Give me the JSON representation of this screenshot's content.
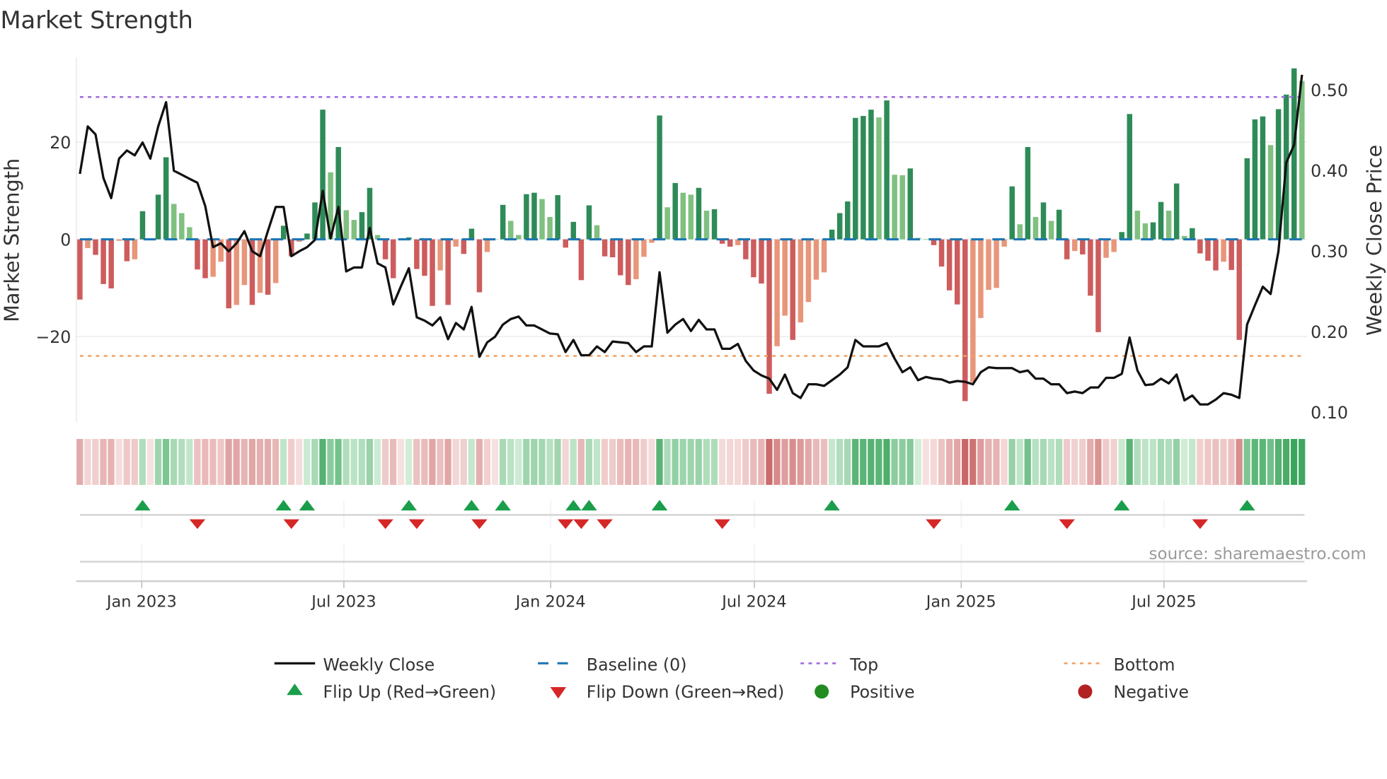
{
  "title": "Market Strength",
  "source": "source: sharemaestro.com",
  "chart_data": {
    "type": "bar",
    "title": "Market Strength",
    "ylabel": "Market Strength",
    "y2label": "Weekly Close Price",
    "ylim": [
      -37.5,
      37.5
    ],
    "y2lim": [
      0.082,
      0.56
    ],
    "yticks": [
      {
        "value": 20,
        "label": "20"
      },
      {
        "value": 0,
        "label": "0"
      },
      {
        "value": -20,
        "label": "−20"
      }
    ],
    "y2ticks": [
      {
        "value": 0.5,
        "label": "0.50"
      },
      {
        "value": 0.4,
        "label": "0.40"
      },
      {
        "value": 0.3,
        "label": "0.30"
      },
      {
        "value": 0.2,
        "label": "0.20"
      },
      {
        "value": 0.1,
        "label": "0.10"
      }
    ],
    "xticks": [
      {
        "week": 7.9,
        "label": "Jan 2023"
      },
      {
        "week": 33.7,
        "label": "Jul 2023"
      },
      {
        "week": 60.1,
        "label": "Jan 2024"
      },
      {
        "week": 86.1,
        "label": "Jul 2024"
      },
      {
        "week": 112.5,
        "label": "Jan 2025"
      },
      {
        "week": 138.4,
        "label": "Jul 2025"
      }
    ],
    "top_level": 29.3,
    "bottom_level": -24,
    "baseline": 0,
    "strength": [
      -12.4,
      -1.8,
      -3.2,
      -9.2,
      -10.1,
      -0.3,
      -4.5,
      -4.1,
      5.8,
      0,
      9.2,
      16.9,
      7.3,
      5.4,
      2.5,
      -6.2,
      -8,
      -7.7,
      -4.6,
      -14.2,
      -13.5,
      -9.4,
      -13.5,
      -11,
      -11.4,
      -9,
      2.8,
      -3.5,
      -0.5,
      1.2,
      7.6,
      26.7,
      13.8,
      19,
      6,
      4,
      5.6,
      10.6,
      0.9,
      -4.1,
      -8,
      0,
      0.4,
      -6.1,
      -7.5,
      -13.7,
      -6.4,
      -13.5,
      -1.5,
      -3,
      2.2,
      -10.9,
      -2.6,
      0,
      7.1,
      3.8,
      0.9,
      9.3,
      9.6,
      8.3,
      4.6,
      9.1,
      -1.7,
      3.6,
      -8.4,
      7,
      2.9,
      -3.5,
      -3.7,
      -7.4,
      -9.4,
      -8.2,
      -3.6,
      -0.7,
      25.5,
      6.6,
      11.6,
      9.6,
      9.2,
      10.6,
      5.9,
      6.2,
      -0.9,
      -1.5,
      -1.2,
      -4.1,
      -7.8,
      -9.1,
      -31.8,
      -22,
      -15.7,
      -20.7,
      -17.1,
      -12.9,
      -8.3,
      -6.8,
      2,
      5.4,
      7.8,
      25,
      25.4,
      26.7,
      25.1,
      28.6,
      13.3,
      13.2,
      14.6,
      0.3,
      0,
      -1.2,
      -5.6,
      -10.5,
      -13.4,
      -33.3,
      -29.4,
      -16.2,
      -10.4,
      -10,
      -1.5,
      10.9,
      3.1,
      19,
      4.6,
      7.6,
      3.8,
      6.1,
      -4.1,
      -2.4,
      -3.1,
      -11.6,
      -19.1,
      -3.8,
      -2.6,
      1.5,
      25.8,
      5.9,
      3.3,
      3.5,
      7.7,
      5.9,
      11.5,
      0.7,
      2.3,
      -2.9,
      -4.4,
      -6.4,
      -4.6,
      -6.3,
      -20.7,
      16.7,
      24.7,
      25.3,
      19.4,
      26.8,
      29.8,
      35.2,
      32.6
    ],
    "strong": [
      1,
      0,
      1,
      1,
      1,
      0,
      1,
      0,
      1,
      1,
      1,
      1,
      0,
      0,
      0,
      1,
      1,
      0,
      0,
      1,
      0,
      0,
      1,
      0,
      1,
      0,
      1,
      1,
      0,
      1,
      1,
      1,
      0,
      1,
      0,
      0,
      1,
      1,
      0,
      1,
      1,
      0,
      1,
      1,
      1,
      1,
      0,
      1,
      0,
      1,
      1,
      1,
      0,
      0,
      1,
      0,
      0,
      1,
      1,
      0,
      0,
      1,
      1,
      1,
      1,
      1,
      0,
      1,
      1,
      1,
      1,
      0,
      0,
      0,
      1,
      0,
      1,
      0,
      0,
      1,
      0,
      1,
      1,
      1,
      0,
      1,
      1,
      1,
      1,
      0,
      0,
      1,
      0,
      0,
      0,
      0,
      1,
      1,
      1,
      1,
      1,
      1,
      0,
      1,
      0,
      0,
      1,
      0,
      0,
      1,
      1,
      1,
      1,
      1,
      0,
      0,
      0,
      0,
      0,
      1,
      0,
      1,
      0,
      1,
      0,
      1,
      1,
      0,
      1,
      1,
      1,
      0,
      0,
      1,
      1,
      0,
      0,
      1,
      1,
      0,
      1,
      0,
      1,
      1,
      1,
      1,
      0,
      1,
      1,
      1,
      1,
      1,
      0,
      1,
      1,
      1,
      0
    ],
    "weekly_close": [
      0.396,
      0.455,
      0.445,
      0.391,
      0.366,
      0.415,
      0.425,
      0.419,
      0.435,
      0.415,
      0.455,
      0.485,
      0.4,
      0.395,
      0.39,
      0.385,
      0.356,
      0.305,
      0.31,
      0.3,
      0.31,
      0.325,
      0.3,
      0.294,
      0.325,
      0.355,
      0.355,
      0.294,
      0.3,
      0.305,
      0.314,
      0.375,
      0.316,
      0.355,
      0.275,
      0.28,
      0.28,
      0.329,
      0.285,
      0.28,
      0.234,
      0.257,
      0.279,
      0.218,
      0.214,
      0.208,
      0.218,
      0.191,
      0.211,
      0.203,
      0.231,
      0.169,
      0.187,
      0.194,
      0.209,
      0.216,
      0.219,
      0.208,
      0.208,
      0.203,
      0.198,
      0.197,
      0.175,
      0.19,
      0.171,
      0.171,
      0.182,
      0.175,
      0.188,
      0.187,
      0.186,
      0.175,
      0.182,
      0.182,
      0.274,
      0.199,
      0.209,
      0.216,
      0.201,
      0.215,
      0.203,
      0.203,
      0.179,
      0.179,
      0.185,
      0.164,
      0.152,
      0.146,
      0.142,
      0.128,
      0.147,
      0.124,
      0.118,
      0.135,
      0.135,
      0.133,
      0.14,
      0.147,
      0.156,
      0.19,
      0.182,
      0.182,
      0.182,
      0.186,
      0.167,
      0.15,
      0.156,
      0.14,
      0.144,
      0.142,
      0.141,
      0.137,
      0.139,
      0.138,
      0.135,
      0.15,
      0.156,
      0.155,
      0.155,
      0.155,
      0.15,
      0.152,
      0.142,
      0.142,
      0.135,
      0.135,
      0.124,
      0.126,
      0.124,
      0.131,
      0.131,
      0.143,
      0.143,
      0.148,
      0.193,
      0.152,
      0.134,
      0.135,
      0.142,
      0.136,
      0.147,
      0.115,
      0.121,
      0.11,
      0.11,
      0.116,
      0.124,
      0.122,
      0.118,
      0.209,
      0.233,
      0.256,
      0.247,
      0.3,
      0.41,
      0.432,
      0.519
    ],
    "flip_up_weeks": [
      8,
      26,
      29,
      42,
      50,
      54,
      63,
      65,
      74,
      96,
      119,
      133,
      149
    ],
    "flip_down_weeks": [
      15,
      27,
      39,
      43,
      51,
      62,
      64,
      67,
      82,
      109,
      126,
      143
    ],
    "legend_position": "bottom",
    "colors": {
      "strong_positive": "#2e8b57",
      "weak_positive": "#80c080",
      "strong_negative": "#cd5c5c",
      "weak_negative": "#e8967a",
      "baseline": "#1f77b4",
      "top": "#a066dd",
      "bottom": "#f2a060",
      "price": "#111111",
      "flip_up": "#1a9e4b",
      "flip_down": "#d62728",
      "positive": "#228b22",
      "negative": "#b22222"
    }
  },
  "legend": {
    "weekly_close": "Weekly Close",
    "baseline": "Baseline (0)",
    "top": "Top",
    "bottom": "Bottom",
    "flip_up": "Flip Up (Red→Green)",
    "flip_down": "Flip Down (Green→Red)",
    "positive": "Positive",
    "negative": "Negative"
  }
}
